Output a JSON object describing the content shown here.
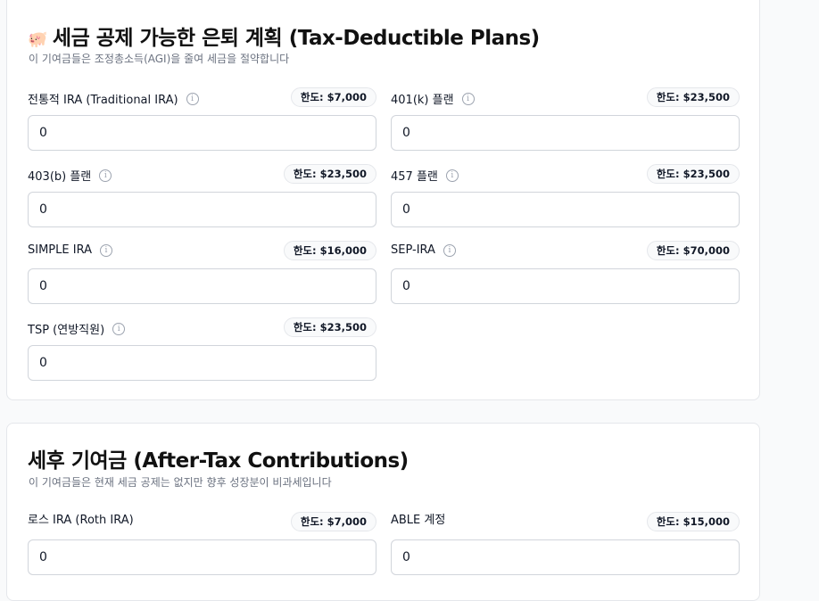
{
  "sections": [
    {
      "icon": "piggy-bank-icon",
      "icon_glyph": "🐖",
      "title": "세금 공제 가능한 은퇴 계획 (Tax-Deductible Plans)",
      "subtitle": "이 기여금들은 조정총소득(AGI)을 줄여 세금을 절약합니다",
      "fields": [
        {
          "label": "전통적 IRA (Traditional IRA)",
          "limit": "한도: $7,000",
          "value": "0",
          "info": true
        },
        {
          "label": "401(k) 플랜",
          "limit": "한도: $23,500",
          "value": "0",
          "info": true
        },
        {
          "label": "403(b) 플랜",
          "limit": "한도: $23,500",
          "value": "0",
          "info": true
        },
        {
          "label": "457 플랜",
          "limit": "한도: $23,500",
          "value": "0",
          "info": true
        },
        {
          "label": "SIMPLE IRA",
          "limit": "한도: $16,000",
          "value": "0",
          "info": true
        },
        {
          "label": "SEP-IRA",
          "limit": "한도: $70,000",
          "value": "0",
          "info": true
        },
        {
          "label": "TSP (연방직원)",
          "limit": "한도: $23,500",
          "value": "0",
          "info": true
        }
      ]
    },
    {
      "title": "세후 기여금 (After-Tax Contributions)",
      "subtitle": "이 기여금들은 현재 세금 공제는 없지만 향후 성장분이 비과세입니다",
      "fields": [
        {
          "label": "로스 IRA (Roth IRA)",
          "limit": "한도: $7,000",
          "value": "0",
          "info": false
        },
        {
          "label": "ABLE 계정",
          "limit": "한도: $15,000",
          "value": "0",
          "info": false
        }
      ]
    }
  ],
  "info_glyph": "i"
}
